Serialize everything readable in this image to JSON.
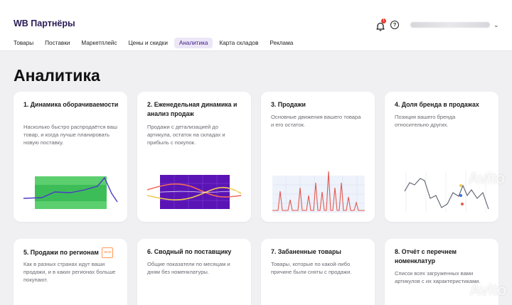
{
  "header": {
    "brand": "WB Партнёры",
    "notifications_count": "1",
    "help_glyph": "?",
    "user_chevron": "⌄"
  },
  "nav": {
    "items": [
      {
        "label": "Товары"
      },
      {
        "label": "Поставки"
      },
      {
        "label": "Маркетплейс"
      },
      {
        "label": "Цены и скидки"
      },
      {
        "label": "Аналитика",
        "active": true
      },
      {
        "label": "Карта складов"
      },
      {
        "label": "Реклама"
      }
    ]
  },
  "page": {
    "title": "Аналитика"
  },
  "cards": [
    {
      "title": "1. Динамика оборачиваемости",
      "desc": "Насколько быстро распродаётся ваш товар, и когда лучше планировать новую поставку."
    },
    {
      "title": "2. Еженедельная динамика и анализ продаж",
      "desc": "Продажи с детализацией до артикула, остаток на складах и прибыль с покупок."
    },
    {
      "title": "3. Продажи",
      "desc": "Основные движения вашего товара и его остаток."
    },
    {
      "title": "4. Доля бренда в продажах",
      "desc": "Позиция вашего бренда относительно других."
    },
    {
      "title": "5. Продажи по регионам",
      "badge": "NEW",
      "desc": "Как в разных странах идут ваши продажи, и в каких регионах больше покупают."
    },
    {
      "title": "6. Сводный по поставщику",
      "desc": "Общие показатели по месяцам и дням без номенклатуры."
    },
    {
      "title": "7. Забаненные товары",
      "desc": "Товары, которые по какой-либо причине были сняты с продажи."
    },
    {
      "title": "8. Отчёт с перечнем номенклатур",
      "desc": "Список всех загруженных вами артикулов с их характеристиками."
    }
  ],
  "watermark": "Avito",
  "colors": {
    "accent": "#3d1a86",
    "green_fill": "#5ccf6f",
    "purple_fill": "#5a14b5",
    "sales_line": "#e25a4f",
    "chart_line": "#5b5f6e"
  }
}
